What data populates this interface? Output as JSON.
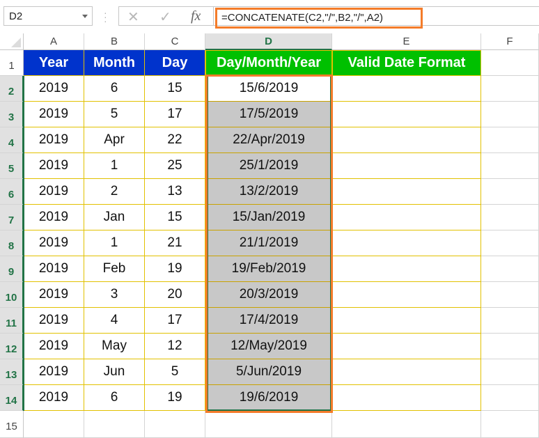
{
  "formula_bar": {
    "name_box": "D2",
    "cancel_icon": "✕",
    "enter_icon": "✓",
    "fx_icon": "fx",
    "formula": "=CONCATENATE(C2,\"/\",B2,\"/\",A2)"
  },
  "columns": [
    "A",
    "B",
    "C",
    "D",
    "E",
    "F"
  ],
  "selected_column": "D",
  "row_numbers": [
    "1",
    "2",
    "3",
    "4",
    "5",
    "6",
    "7",
    "8",
    "9",
    "10",
    "11",
    "12",
    "13",
    "14",
    "15"
  ],
  "headers": {
    "year": "Year",
    "month": "Month",
    "day": "Day",
    "combined": "Day/Month/Year",
    "valid": "Valid Date Format"
  },
  "rows": [
    {
      "year": "2019",
      "month": "6",
      "day": "15",
      "combined": "15/6/2019",
      "valid": ""
    },
    {
      "year": "2019",
      "month": "5",
      "day": "17",
      "combined": "17/5/2019",
      "valid": ""
    },
    {
      "year": "2019",
      "month": "Apr",
      "day": "22",
      "combined": "22/Apr/2019",
      "valid": ""
    },
    {
      "year": "2019",
      "month": "1",
      "day": "25",
      "combined": "25/1/2019",
      "valid": ""
    },
    {
      "year": "2019",
      "month": "2",
      "day": "13",
      "combined": "13/2/2019",
      "valid": ""
    },
    {
      "year": "2019",
      "month": "Jan",
      "day": "15",
      "combined": "15/Jan/2019",
      "valid": ""
    },
    {
      "year": "2019",
      "month": "1",
      "day": "21",
      "combined": "21/1/2019",
      "valid": ""
    },
    {
      "year": "2019",
      "month": "Feb",
      "day": "19",
      "combined": "19/Feb/2019",
      "valid": ""
    },
    {
      "year": "2019",
      "month": "3",
      "day": "20",
      "combined": "20/3/2019",
      "valid": ""
    },
    {
      "year": "2019",
      "month": "4",
      "day": "17",
      "combined": "17/4/2019",
      "valid": ""
    },
    {
      "year": "2019",
      "month": "May",
      "day": "12",
      "combined": "12/May/2019",
      "valid": ""
    },
    {
      "year": "2019",
      "month": "Jun",
      "day": "5",
      "combined": "5/Jun/2019",
      "valid": ""
    },
    {
      "year": "2019",
      "month": "6",
      "day": "19",
      "combined": "19/6/2019",
      "valid": ""
    }
  ],
  "colors": {
    "header_blue": "#0033cc",
    "header_green": "#00c000",
    "selection_orange": "#f47c2a",
    "excel_green": "#217346",
    "cell_border_yellow": "#e2c100",
    "selected_fill": "#c8c8c8"
  }
}
